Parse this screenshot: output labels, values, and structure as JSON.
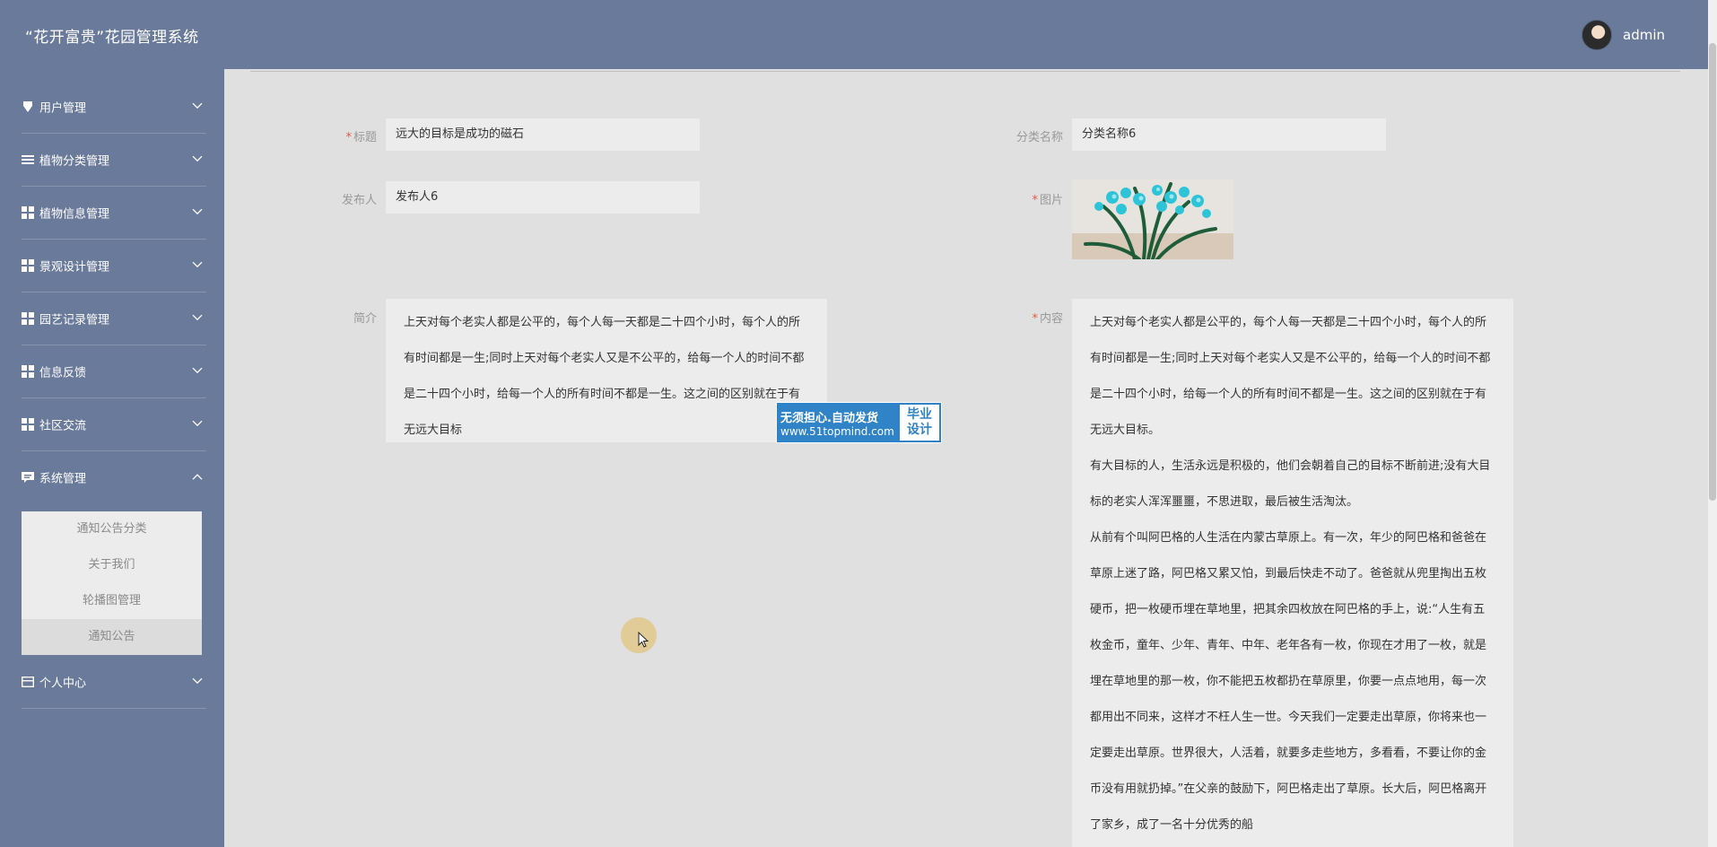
{
  "header": {
    "app_title": "“花开富贵”花园管理系统",
    "user_name": "admin"
  },
  "sidebar": {
    "items": [
      {
        "label": "用户管理",
        "icon": "user-icon"
      },
      {
        "label": "植物分类管理",
        "icon": "list-icon"
      },
      {
        "label": "植物信息管理",
        "icon": "grid-icon"
      },
      {
        "label": "景观设计管理",
        "icon": "grid-icon"
      },
      {
        "label": "园艺记录管理",
        "icon": "grid-icon"
      },
      {
        "label": "信息反馈",
        "icon": "grid-icon"
      },
      {
        "label": "社区交流",
        "icon": "grid-icon"
      },
      {
        "label": "系统管理",
        "icon": "chat-icon"
      },
      {
        "label": "个人中心",
        "icon": "card-icon"
      }
    ],
    "submenu": [
      {
        "label": "通知公告分类"
      },
      {
        "label": "关于我们"
      },
      {
        "label": "轮播图管理"
      },
      {
        "label": "通知公告"
      }
    ]
  },
  "form": {
    "title_label": "标题",
    "title_value": "远大的目标是成功的磁石",
    "category_label": "分类名称",
    "category_value": "分类名称6",
    "publisher_label": "发布人",
    "publisher_value": "发布人6",
    "image_label": "图片",
    "summary_label": "简介",
    "summary_text": "上天对每个老实人都是公平的，每个人每一天都是二十四个小时，每个人的所有时间都是一生;同时上天对每个老实人又是不公平的，给每一个人的时间不都是二十四个小时，给每一个人的所有时间不都是一生。这之间的区别就在于有无远大目标",
    "content_label": "内容",
    "content_paragraphs": [
      "上天对每个老实人都是公平的，每个人每一天都是二十四个小时，每个人的所有时间都是一生;同时上天对每个老实人又是不公平的，给每一个人的时间不都是二十四个小时，给每一个人的所有时间不都是一生。这之间的区别就在于有无远大目标。",
      "有大目标的人，生活永远是积极的，他们会朝着自己的目标不断前进;没有大目标的老实人浑浑噩噩，不思进取，最后被生活淘汰。",
      "从前有个叫阿巴格的人生活在内蒙古草原上。有一次，年少的阿巴格和爸爸在草原上迷了路，阿巴格又累又怕，到最后快走不动了。爸爸就从兜里掏出五枚硬币，把一枚硬币埋在草地里，把其余四枚放在阿巴格的手上，说:“人生有五枚金币，童年、少年、青年、中年、老年各有一枚，你现在才用了一枚，就是埋在草地里的那一枚，你不能把五枚都扔在草原里，你要一点点地用，每一次都用出不同来，这样才不枉人生一世。今天我们一定要走出草原，你将来也一定要走出草原。世界很大，人活着，就要多走些地方，多看看，不要让你的金币没有用就扔掉。”在父亲的鼓励下，阿巴格走出了草原。长大后，阿巴格离开了家乡，成了一名十分优秀的船"
    ]
  },
  "watermark": {
    "line1": "无须担心.自动发货",
    "line2": "www.51topmind.com",
    "badge_top": "毕业",
    "badge_bottom": "设计"
  }
}
